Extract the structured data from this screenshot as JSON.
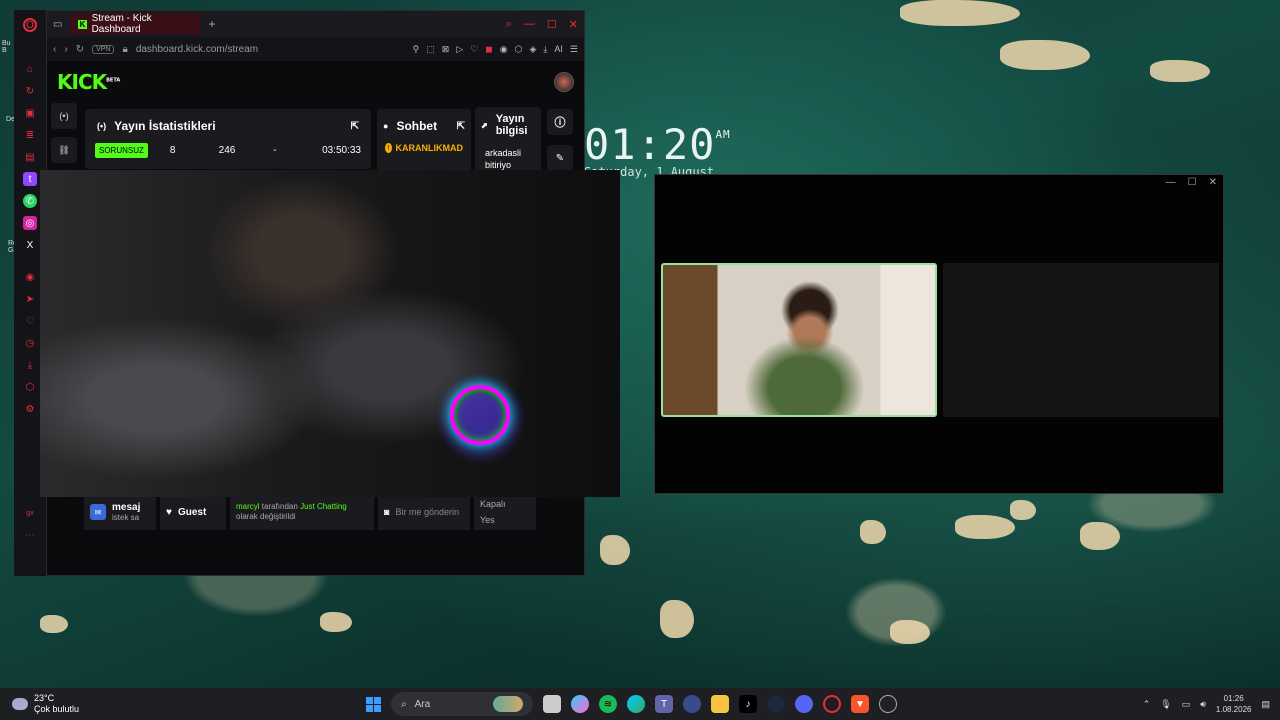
{
  "desktop": {
    "time": "01:20",
    "ampm": "AM",
    "date": "Saturday, 1 August",
    "left_labels": [
      "Bu B",
      "De",
      "Ro Ga"
    ]
  },
  "browser": {
    "tab_title": "Stream - Kick Dashboard",
    "url": "dashboard.kick.com/stream",
    "vpn": "VPN",
    "ai_label": "AI"
  },
  "kick": {
    "logo": "KICK",
    "beta": "BETA",
    "stats_panel_title": "Yayın İstatistikleri",
    "status_badge": "SORUNSUZ",
    "stat_viewers": "8",
    "stat_followers": "246",
    "stat_dash": "-",
    "stat_duration": "03:50:33",
    "chat_title": "Sohbet",
    "chat_user": "KARANLIKMAD",
    "info_title": "Yayın bilgisi",
    "info_text": "arkadasli bitiriyo",
    "bottom": {
      "msg_label": "mesaj",
      "msg_sub": "istek sa",
      "guest": "Guest",
      "activity_user": "marcyl",
      "activity_mid": "tarafından",
      "activity_cat": "Just Chatting",
      "activity_end": "olarak değiştirildi",
      "send_text": "Bir me gönderin",
      "closed": "Kapalı",
      "yes": "Yes"
    }
  },
  "taskbar": {
    "temp": "23°C",
    "weather": "Çok bulutlu",
    "search_placeholder": "Ara",
    "time": "01:26",
    "date": "1.08.2026"
  },
  "colors": {
    "kick_green": "#53fc18",
    "opera_red": "#e0303c"
  }
}
